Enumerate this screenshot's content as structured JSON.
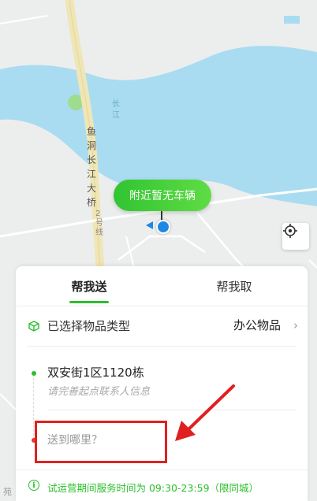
{
  "map": {
    "pin_label": "附近暂无车辆",
    "bridge_label": "鱼洞长江大桥",
    "river_label": "长江",
    "road_label": "2号线",
    "corner_label": "苑"
  },
  "tabs": [
    {
      "label": "帮我送",
      "active": true
    },
    {
      "label": "帮我取",
      "active": false
    }
  ],
  "item_type": {
    "label": "已选择物品类型",
    "value": "办公物品"
  },
  "from": {
    "title": "双安街1区1120栋",
    "subtitle": "请完善起点联系人信息"
  },
  "to": {
    "placeholder": "送到哪里？"
  },
  "notice": "试运营期间服务时间为 09:30-23:59（限同城）",
  "colors": {
    "accent": "#2bbf2b",
    "river": "#a9dcf1",
    "annotation": "#e02020"
  }
}
